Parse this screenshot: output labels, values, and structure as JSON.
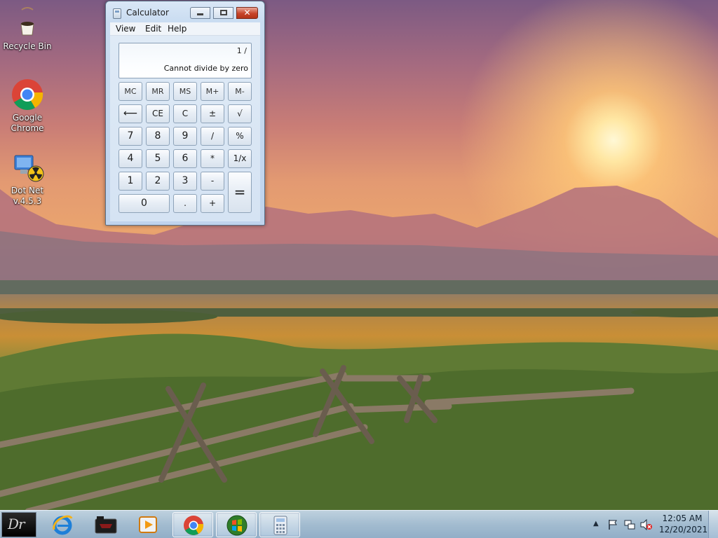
{
  "desktop": {
    "icons": [
      {
        "label": "Recycle Bin",
        "icon": "recycle-bin-icon"
      },
      {
        "label": "Google Chrome",
        "icon": "chrome-icon"
      },
      {
        "label": "Dot Net v.4.5.3",
        "icon": "dotnet-installer-icon"
      }
    ]
  },
  "calculator": {
    "title": "Calculator",
    "window_buttons": {
      "minimize": "minimize-icon",
      "maximize": "maximize-icon",
      "close": "close-icon"
    },
    "menu": [
      "View",
      "Edit",
      "Help"
    ],
    "display": {
      "expression": "1 /",
      "result": "Cannot divide by zero"
    },
    "keys": {
      "mc": "MC",
      "mr": "MR",
      "ms": "MS",
      "mplus": "M+",
      "mminus": "M-",
      "back": "⟵",
      "ce": "CE",
      "c": "C",
      "plusminus": "±",
      "sqrt": "√",
      "k7": "7",
      "k8": "8",
      "k9": "9",
      "div": "/",
      "pct": "%",
      "k4": "4",
      "k5": "5",
      "k6": "6",
      "mul": "*",
      "recip": "1/x",
      "k1": "1",
      "k2": "2",
      "k3": "3",
      "sub": "-",
      "eq": "=",
      "k0": "0",
      "dot": ".",
      "add": "+"
    }
  },
  "taskbar": {
    "start_label": "Dr",
    "items": [
      {
        "name": "internet-explorer",
        "icon": "internet-explorer-icon"
      },
      {
        "name": "media-app",
        "icon": "media-app-icon"
      },
      {
        "name": "video-player",
        "icon": "video-player-icon"
      },
      {
        "name": "chrome",
        "icon": "chrome-icon"
      },
      {
        "name": "windows-media",
        "icon": "windows-orb-icon"
      },
      {
        "name": "calculator",
        "icon": "calculator-icon"
      }
    ],
    "tray": {
      "time": "12:05 AM",
      "date": "12/20/2021",
      "icons": [
        "show-hidden-icons-icon",
        "action-center-flag-icon",
        "network-icon",
        "volume-muted-icon"
      ]
    }
  },
  "colors": {
    "accent": "#c7452a",
    "window_frame": "#c9dcf1",
    "taskbar": "#aac3de"
  }
}
